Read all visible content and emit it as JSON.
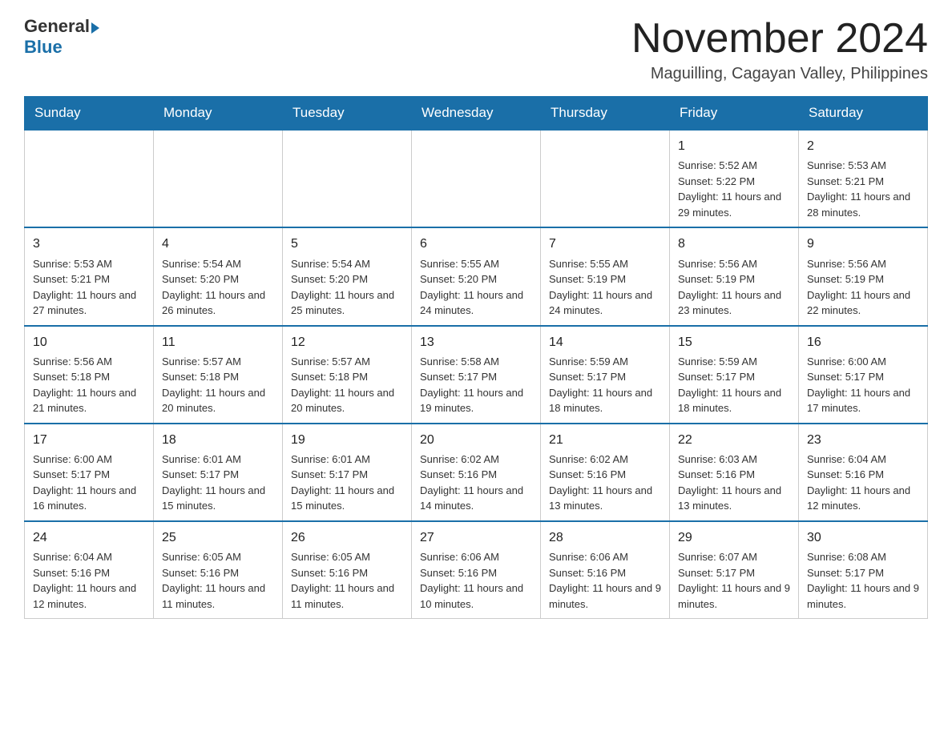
{
  "header": {
    "logo": {
      "general": "General",
      "blue": "Blue"
    },
    "title": "November 2024",
    "subtitle": "Maguilling, Cagayan Valley, Philippines"
  },
  "calendar": {
    "days_of_week": [
      "Sunday",
      "Monday",
      "Tuesday",
      "Wednesday",
      "Thursday",
      "Friday",
      "Saturday"
    ],
    "weeks": [
      [
        {
          "day": "",
          "info": ""
        },
        {
          "day": "",
          "info": ""
        },
        {
          "day": "",
          "info": ""
        },
        {
          "day": "",
          "info": ""
        },
        {
          "day": "",
          "info": ""
        },
        {
          "day": "1",
          "info": "Sunrise: 5:52 AM\nSunset: 5:22 PM\nDaylight: 11 hours and 29 minutes."
        },
        {
          "day": "2",
          "info": "Sunrise: 5:53 AM\nSunset: 5:21 PM\nDaylight: 11 hours and 28 minutes."
        }
      ],
      [
        {
          "day": "3",
          "info": "Sunrise: 5:53 AM\nSunset: 5:21 PM\nDaylight: 11 hours and 27 minutes."
        },
        {
          "day": "4",
          "info": "Sunrise: 5:54 AM\nSunset: 5:20 PM\nDaylight: 11 hours and 26 minutes."
        },
        {
          "day": "5",
          "info": "Sunrise: 5:54 AM\nSunset: 5:20 PM\nDaylight: 11 hours and 25 minutes."
        },
        {
          "day": "6",
          "info": "Sunrise: 5:55 AM\nSunset: 5:20 PM\nDaylight: 11 hours and 24 minutes."
        },
        {
          "day": "7",
          "info": "Sunrise: 5:55 AM\nSunset: 5:19 PM\nDaylight: 11 hours and 24 minutes."
        },
        {
          "day": "8",
          "info": "Sunrise: 5:56 AM\nSunset: 5:19 PM\nDaylight: 11 hours and 23 minutes."
        },
        {
          "day": "9",
          "info": "Sunrise: 5:56 AM\nSunset: 5:19 PM\nDaylight: 11 hours and 22 minutes."
        }
      ],
      [
        {
          "day": "10",
          "info": "Sunrise: 5:56 AM\nSunset: 5:18 PM\nDaylight: 11 hours and 21 minutes."
        },
        {
          "day": "11",
          "info": "Sunrise: 5:57 AM\nSunset: 5:18 PM\nDaylight: 11 hours and 20 minutes."
        },
        {
          "day": "12",
          "info": "Sunrise: 5:57 AM\nSunset: 5:18 PM\nDaylight: 11 hours and 20 minutes."
        },
        {
          "day": "13",
          "info": "Sunrise: 5:58 AM\nSunset: 5:17 PM\nDaylight: 11 hours and 19 minutes."
        },
        {
          "day": "14",
          "info": "Sunrise: 5:59 AM\nSunset: 5:17 PM\nDaylight: 11 hours and 18 minutes."
        },
        {
          "day": "15",
          "info": "Sunrise: 5:59 AM\nSunset: 5:17 PM\nDaylight: 11 hours and 18 minutes."
        },
        {
          "day": "16",
          "info": "Sunrise: 6:00 AM\nSunset: 5:17 PM\nDaylight: 11 hours and 17 minutes."
        }
      ],
      [
        {
          "day": "17",
          "info": "Sunrise: 6:00 AM\nSunset: 5:17 PM\nDaylight: 11 hours and 16 minutes."
        },
        {
          "day": "18",
          "info": "Sunrise: 6:01 AM\nSunset: 5:17 PM\nDaylight: 11 hours and 15 minutes."
        },
        {
          "day": "19",
          "info": "Sunrise: 6:01 AM\nSunset: 5:17 PM\nDaylight: 11 hours and 15 minutes."
        },
        {
          "day": "20",
          "info": "Sunrise: 6:02 AM\nSunset: 5:16 PM\nDaylight: 11 hours and 14 minutes."
        },
        {
          "day": "21",
          "info": "Sunrise: 6:02 AM\nSunset: 5:16 PM\nDaylight: 11 hours and 13 minutes."
        },
        {
          "day": "22",
          "info": "Sunrise: 6:03 AM\nSunset: 5:16 PM\nDaylight: 11 hours and 13 minutes."
        },
        {
          "day": "23",
          "info": "Sunrise: 6:04 AM\nSunset: 5:16 PM\nDaylight: 11 hours and 12 minutes."
        }
      ],
      [
        {
          "day": "24",
          "info": "Sunrise: 6:04 AM\nSunset: 5:16 PM\nDaylight: 11 hours and 12 minutes."
        },
        {
          "day": "25",
          "info": "Sunrise: 6:05 AM\nSunset: 5:16 PM\nDaylight: 11 hours and 11 minutes."
        },
        {
          "day": "26",
          "info": "Sunrise: 6:05 AM\nSunset: 5:16 PM\nDaylight: 11 hours and 11 minutes."
        },
        {
          "day": "27",
          "info": "Sunrise: 6:06 AM\nSunset: 5:16 PM\nDaylight: 11 hours and 10 minutes."
        },
        {
          "day": "28",
          "info": "Sunrise: 6:06 AM\nSunset: 5:16 PM\nDaylight: 11 hours and 9 minutes."
        },
        {
          "day": "29",
          "info": "Sunrise: 6:07 AM\nSunset: 5:17 PM\nDaylight: 11 hours and 9 minutes."
        },
        {
          "day": "30",
          "info": "Sunrise: 6:08 AM\nSunset: 5:17 PM\nDaylight: 11 hours and 9 minutes."
        }
      ]
    ]
  }
}
